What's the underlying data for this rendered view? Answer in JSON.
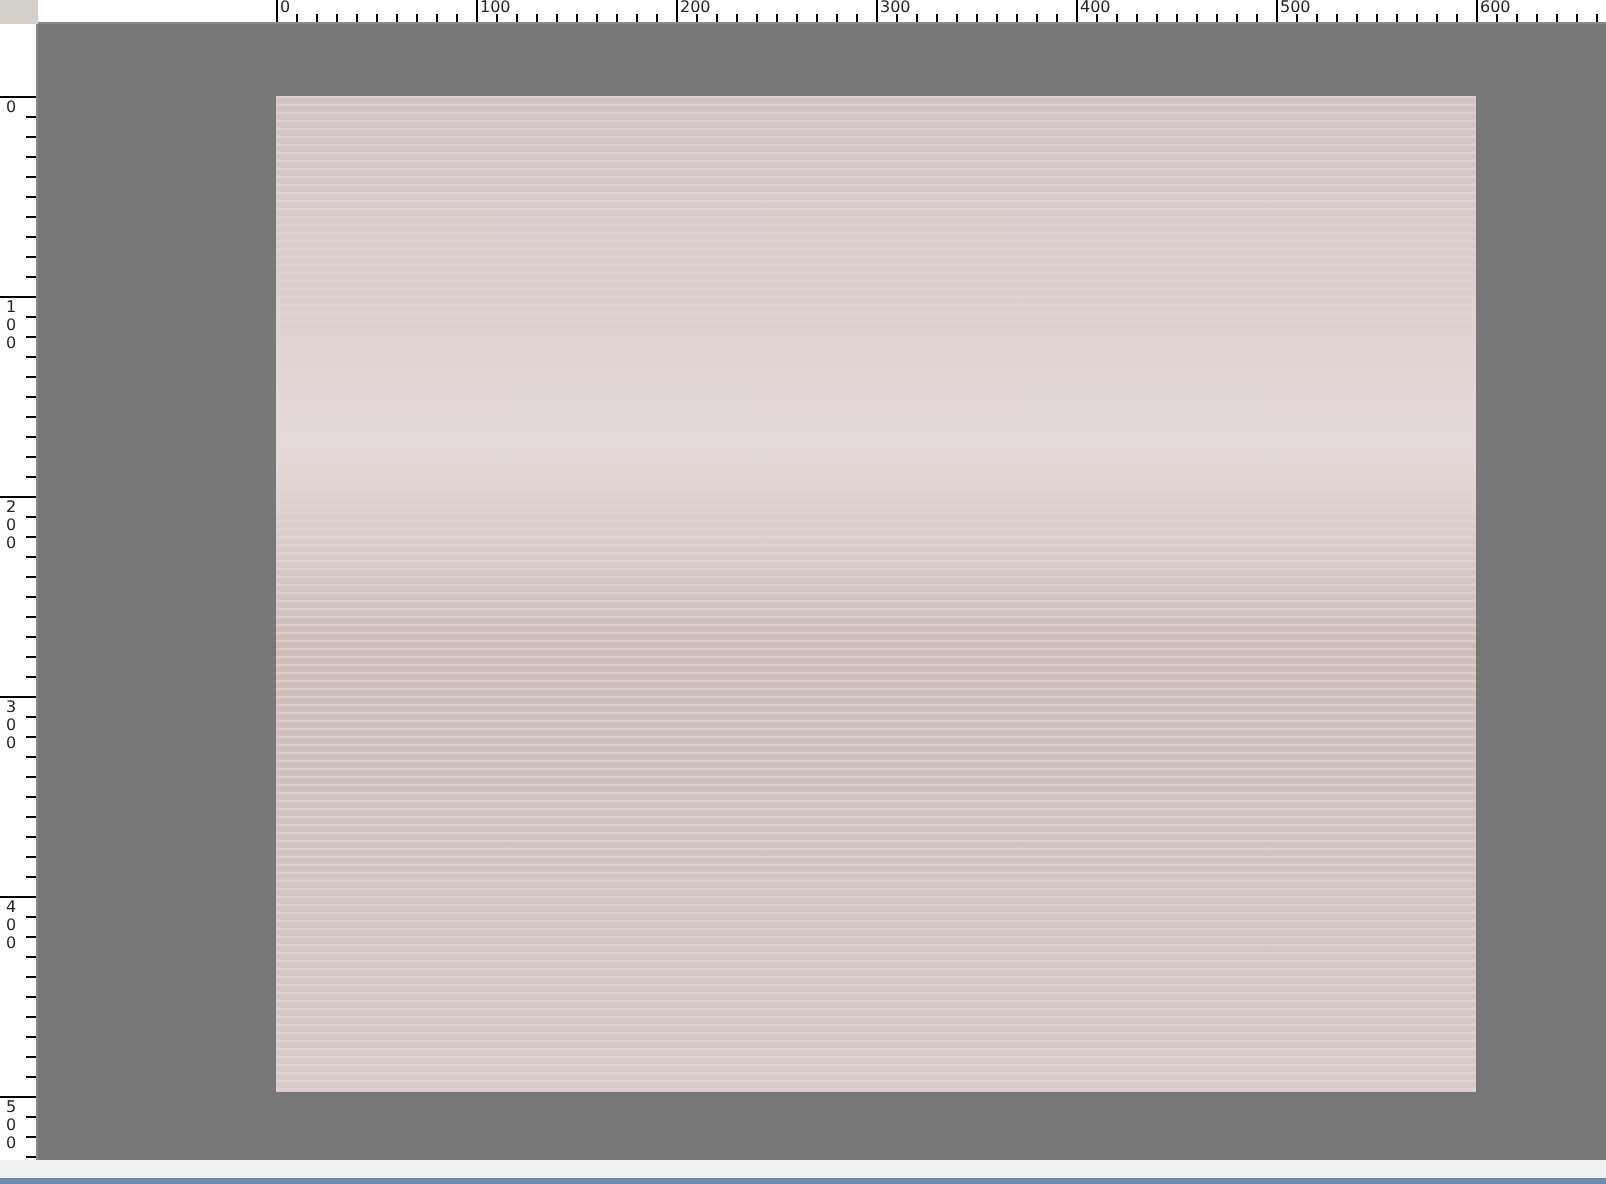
{
  "rulers": {
    "horizontal": [
      "0",
      "100",
      "200",
      "300",
      "400",
      "500",
      "600"
    ],
    "vertical": [
      "0",
      "100",
      "200",
      "300",
      "400",
      "500"
    ]
  }
}
